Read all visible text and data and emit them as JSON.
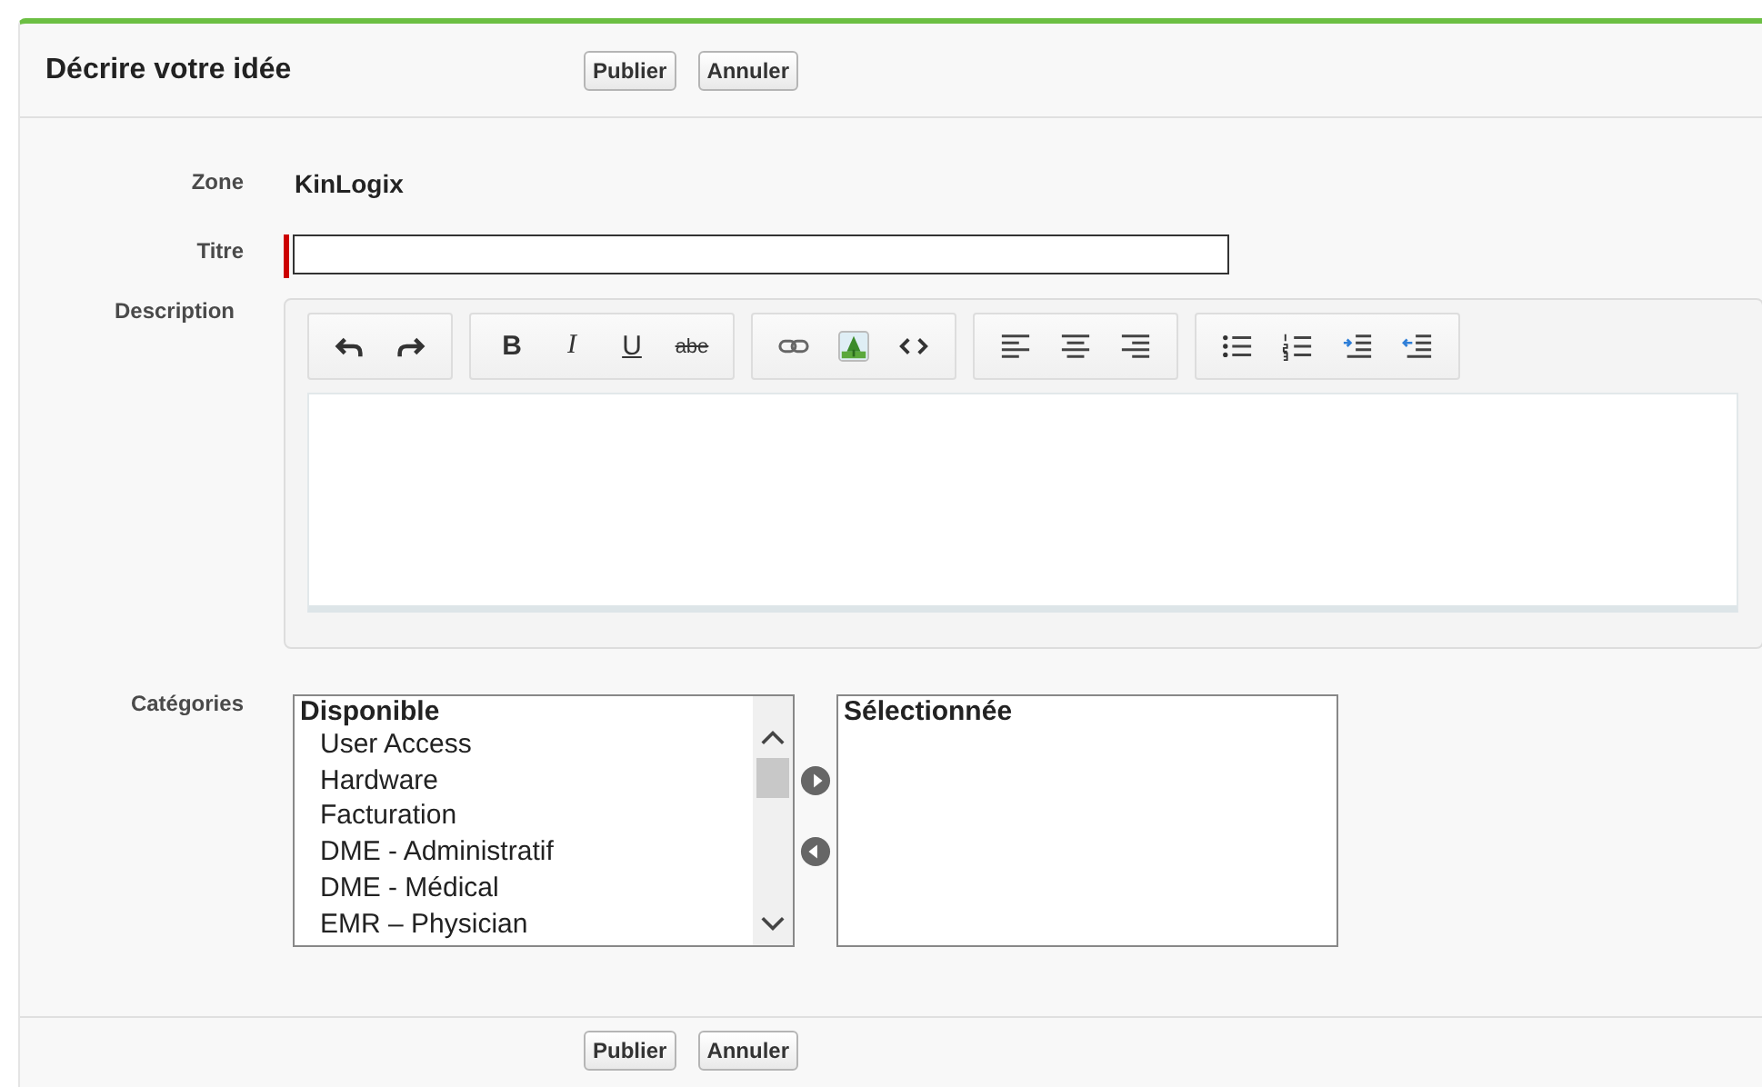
{
  "header": {
    "title": "Décrire votre idée",
    "buttons": [
      "Publier",
      "Annuler"
    ]
  },
  "fields": [
    {
      "kind": "static",
      "label": "Zone",
      "value": "KinLogix"
    },
    {
      "kind": "input",
      "label": "Titre",
      "required": true
    },
    {
      "kind": "editor",
      "label": "Description",
      "toolbar": [
        [
          {
            "kind": "undo"
          },
          {
            "kind": "redo"
          }
        ],
        [
          {
            "kind": "bold",
            "label": "B"
          },
          {
            "kind": "italic",
            "label": "I"
          },
          {
            "kind": "underline",
            "label": "U"
          },
          {
            "kind": "strike",
            "label": "abe"
          }
        ],
        [
          {
            "kind": "link"
          },
          {
            "kind": "image"
          },
          {
            "kind": "code"
          }
        ],
        [
          {
            "kind": "align-left"
          },
          {
            "kind": "align-center"
          },
          {
            "kind": "align-right"
          }
        ],
        [
          {
            "kind": "bullets"
          },
          {
            "kind": "numbers"
          },
          {
            "kind": "indent"
          },
          {
            "kind": "outdent"
          }
        ]
      ]
    },
    {
      "kind": "picker",
      "label": "Catégories",
      "available": {
        "heading": "Disponible",
        "options": [
          "User Access",
          "Hardware",
          "Facturation",
          "DME - Administratif",
          "DME - Médical",
          "EMR – Physician"
        ]
      },
      "selected": {
        "heading": "Sélectionnée"
      }
    }
  ],
  "footer": {
    "buttons": [
      "Publier",
      "Annuler"
    ]
  }
}
